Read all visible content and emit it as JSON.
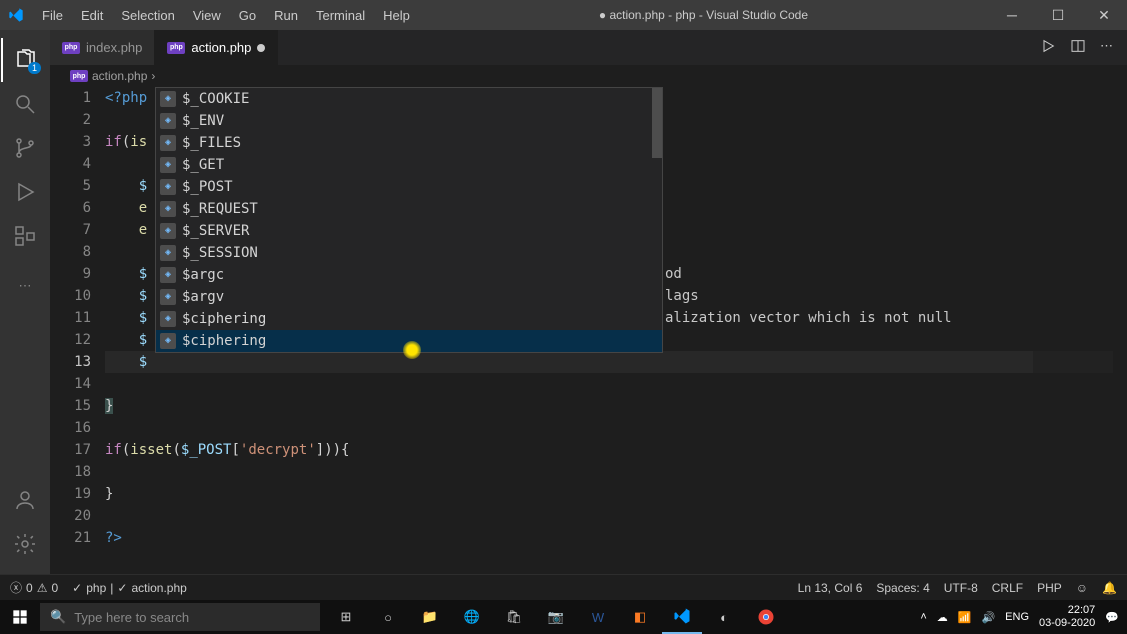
{
  "titlebar": {
    "menus": [
      "File",
      "Edit",
      "Selection",
      "View",
      "Go",
      "Run",
      "Terminal",
      "Help"
    ],
    "title": "● action.php - php - Visual Studio Code"
  },
  "activity": {
    "explorer_badge": "1"
  },
  "tabs": {
    "items": [
      {
        "label": "index.php",
        "modified": false,
        "active": false
      },
      {
        "label": "action.php",
        "modified": true,
        "active": true
      }
    ]
  },
  "breadcrumb": {
    "file": "action.php"
  },
  "editor": {
    "line_numbers": [
      "1",
      "2",
      "3",
      "4",
      "5",
      "6",
      "7",
      "8",
      "9",
      "10",
      "11",
      "12",
      "13",
      "14",
      "15",
      "16",
      "17",
      "18",
      "19",
      "20",
      "21"
    ],
    "lines": {
      "l1_open": "<?php",
      "l3_if": "if",
      "l3_par": "(",
      "l3_is": "is",
      "l5_dollar": "$",
      "l6_e": "e",
      "l7_e": "e",
      "l9_dollar": "$",
      "l10_dollar": "$",
      "l11_dollar": "$",
      "l12_dollar": "$",
      "l13_dollar": "$",
      "l15_brace": "}",
      "l17_if": "if",
      "l17_isset": "isset",
      "l17_var": "$_POST",
      "l17_str": "'decrypt'",
      "l17_rest": "])){",
      "l19_brace": "}",
      "l21_close": "?>"
    },
    "doc_hint": [
      "od",
      "lags",
      "alization vector which is not null"
    ]
  },
  "autocomplete": {
    "items": [
      "$_COOKIE",
      "$_ENV",
      "$_FILES",
      "$_GET",
      "$_POST",
      "$_REQUEST",
      "$_SERVER",
      "$_SESSION",
      "$argc",
      "$argv",
      "$ciphering",
      "$ciphering"
    ],
    "selected_index": 11
  },
  "statusbar": {
    "errors": "0",
    "warnings": "0",
    "lang_server": "php",
    "file": "action.php",
    "ln_col": "Ln 13, Col 6",
    "spaces": "Spaces: 4",
    "encoding": "UTF-8",
    "eol": "CRLF",
    "lang": "PHP"
  },
  "taskbar": {
    "search_placeholder": "Type here to search",
    "time": "22:07",
    "date": "03-09-2020"
  }
}
